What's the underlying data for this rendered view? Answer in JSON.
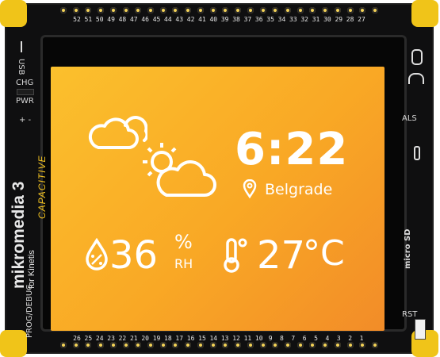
{
  "screen": {
    "time": "6:22",
    "city": "Belgrade",
    "humidity_value": "36",
    "humidity_percent": "%",
    "humidity_unit": "RH",
    "temperature_value": "27",
    "temperature_unit": "°C"
  },
  "board": {
    "brand": "mikromedia 3",
    "brand_sub": "for Kinetis",
    "capacitive": "CAPACITIVE",
    "usb_label": "USB",
    "chg_label": "CHG",
    "pwr_label": "PWR",
    "plus_minus": "+ -",
    "prog_debug": "PROG/DEBUG",
    "als_label": "ALS",
    "micro_sd": "micro SD",
    "rst_label": "RST",
    "top_pins": [
      "52",
      "51",
      "50",
      "49",
      "48",
      "47",
      "46",
      "45",
      "44",
      "43",
      "42",
      "41",
      "40",
      "39",
      "38",
      "37",
      "36",
      "35",
      "34",
      "33",
      "32",
      "31",
      "30",
      "29",
      "28",
      "27"
    ],
    "bottom_pins": [
      "26",
      "25",
      "24",
      "23",
      "22",
      "21",
      "20",
      "19",
      "18",
      "17",
      "16",
      "15",
      "14",
      "13",
      "12",
      "11",
      "10",
      "9",
      "8",
      "7",
      "6",
      "5",
      "4",
      "3",
      "2",
      "1"
    ]
  },
  "colors": {
    "screen_top": "#fbc02d",
    "screen_bottom": "#f28c28",
    "accent_yellow": "#f0c419"
  }
}
